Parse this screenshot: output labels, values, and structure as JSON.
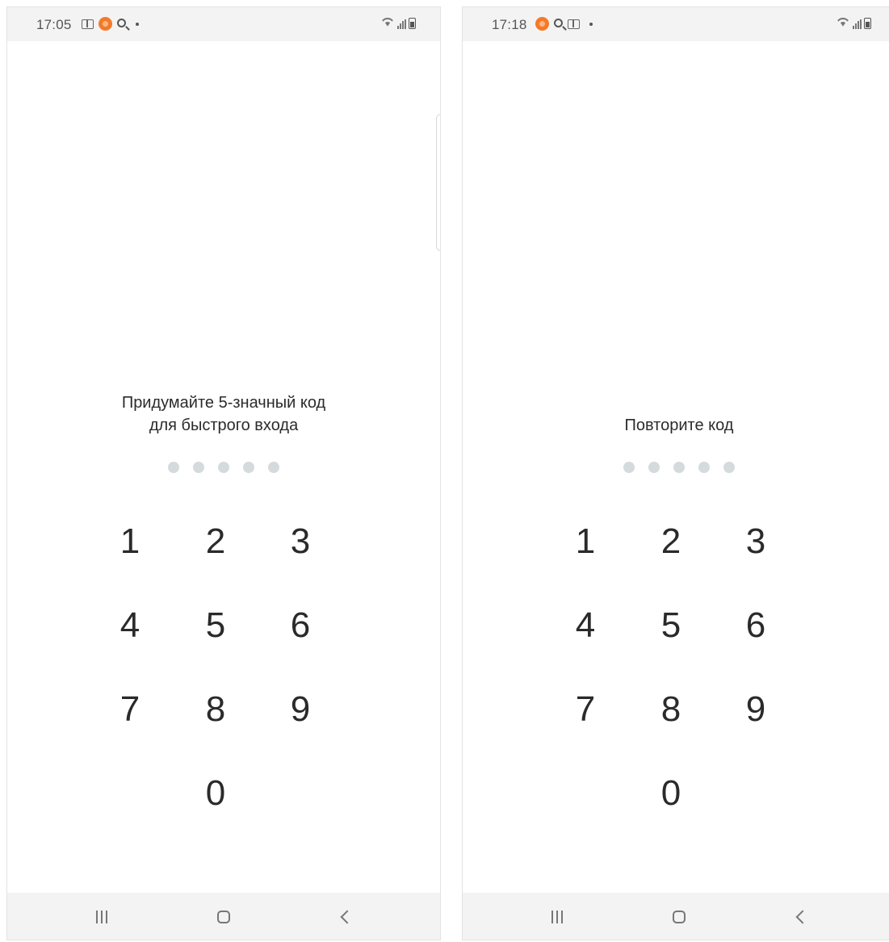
{
  "screens": [
    {
      "status_time": "17:05",
      "prompt_lines": [
        "Придумайте 5-значный код",
        "для быстрого входа"
      ],
      "pin_length": 5,
      "digits_entered": 0,
      "keypad": [
        "1",
        "2",
        "3",
        "4",
        "5",
        "6",
        "7",
        "8",
        "9",
        "0"
      ],
      "status_icons": [
        "book-icon",
        "app-notification-icon",
        "search-icon",
        "dot-icon"
      ]
    },
    {
      "status_time": "17:18",
      "prompt_lines": [
        "Повторите код"
      ],
      "pin_length": 5,
      "digits_entered": 0,
      "keypad": [
        "1",
        "2",
        "3",
        "4",
        "5",
        "6",
        "7",
        "8",
        "9",
        "0"
      ],
      "status_icons": [
        "app-notification-icon",
        "search-icon",
        "book-icon",
        "dot-icon"
      ]
    }
  ],
  "system_icons": [
    "wifi-icon",
    "signal-icon",
    "battery-icon"
  ],
  "nav_icons": [
    "recent-apps-icon",
    "home-icon",
    "back-icon"
  ],
  "colors": {
    "accent_orange": "#f47a2a",
    "pin_dot_empty": "#d5dadd",
    "bar_background": "#f3f3f3",
    "text_primary": "#2b2b2b"
  }
}
